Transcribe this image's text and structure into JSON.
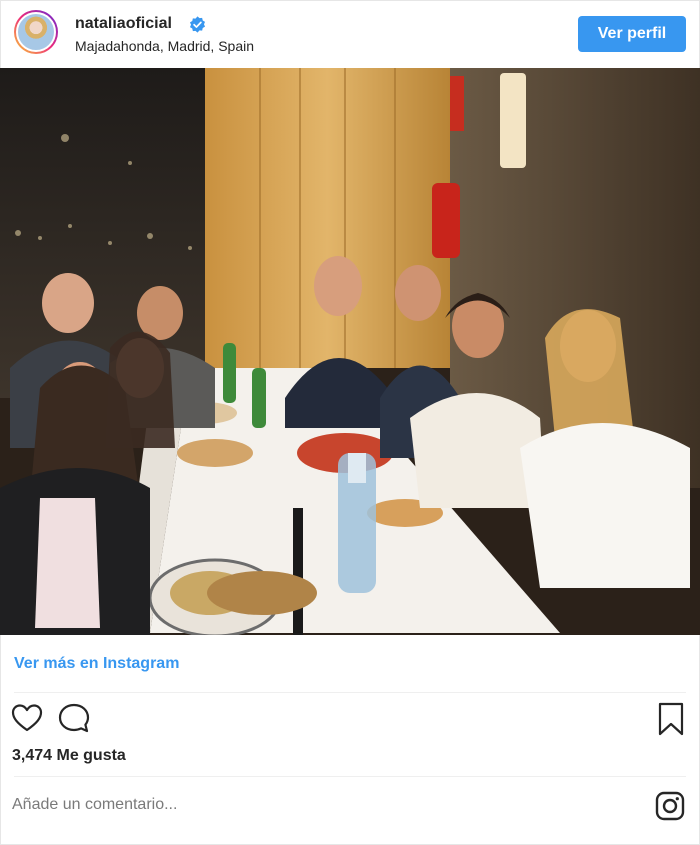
{
  "header": {
    "username": "nataliaoficial",
    "verified_icon": "verified-badge-icon",
    "location": "Majadahonda, Madrid, Spain",
    "profile_button": "Ver perfil"
  },
  "post": {
    "image_alt": "photo"
  },
  "footer": {
    "more_link": "Ver más en Instagram",
    "likes": "3,474 Me gusta",
    "comment_placeholder": "Añade un comentario..."
  },
  "icons": {
    "like": "heart-icon",
    "comment": "comment-icon",
    "save": "bookmark-icon",
    "instagram": "instagram-icon"
  },
  "colors": {
    "accent": "#3897f0",
    "text": "#262626",
    "muted": "#7a7a7a",
    "verified": "#3897f0"
  }
}
